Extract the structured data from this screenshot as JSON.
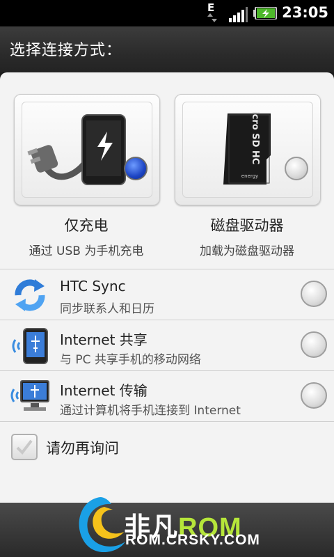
{
  "status_bar": {
    "network_type": "E",
    "time": "23:05"
  },
  "dialog": {
    "title": "选择连接方式："
  },
  "tiles": [
    {
      "label": "仅充电",
      "subtitle": "通过 USB 为手机充电",
      "selected": true
    },
    {
      "label": "磁盘驱动器",
      "subtitle": "加载为磁盘驱动器",
      "selected": false,
      "card_text": "energy",
      "sd_text": "micro SD HC"
    }
  ],
  "options": [
    {
      "title": "HTC Sync",
      "subtitle": "同步联系人和日历",
      "icon": "sync-icon"
    },
    {
      "title": "Internet 共享",
      "subtitle": "与 PC 共享手机的移动网络",
      "icon": "phone-share-icon"
    },
    {
      "title": "Internet 传输",
      "subtitle": "通过计算机将手机连接到 Internet",
      "icon": "computer-share-icon"
    }
  ],
  "dont_ask": {
    "label": "请勿再询问",
    "checked": false
  },
  "watermark": {
    "brand": "非凡",
    "rom": "ROM",
    "url": "ROM.CRSKY.COM"
  },
  "colors": {
    "selected_radio": "#1d45c4",
    "sheet_bg": "#f3f3f3"
  }
}
